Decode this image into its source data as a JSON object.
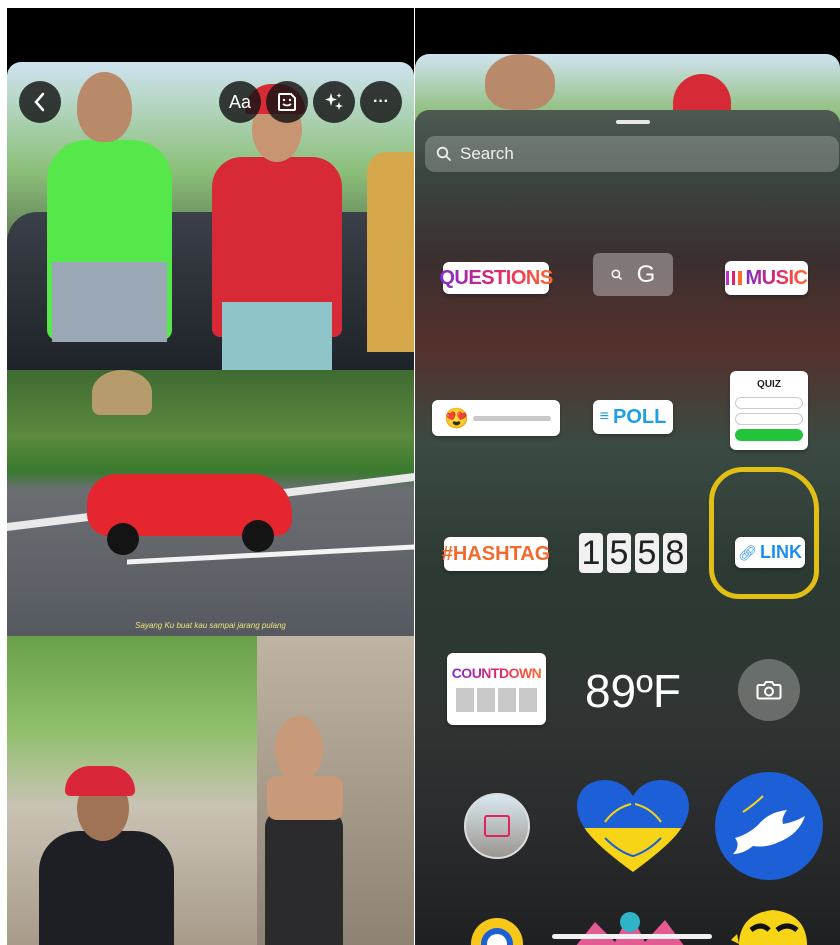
{
  "left_panel": {
    "toolbar": {
      "back_icon": "chevron-left-icon",
      "text_label": "Aa",
      "sticker_icon": "sticker-icon",
      "effects_icon": "sparkles-icon",
      "more_label": "···"
    },
    "caption": "Sayang Ku buat kau sampai jarang pulang"
  },
  "right_panel": {
    "search": {
      "placeholder": "Search",
      "icon": "search-icon"
    },
    "stickers": {
      "questions": "QUESTIONS",
      "gif_letter": "G",
      "music": "MUSIC",
      "poll": "POLL",
      "quiz_title": "QUIZ",
      "hashtag": "#HASHTAG",
      "time_digits": [
        "1",
        "5",
        "5",
        "8"
      ],
      "link": "LINK",
      "countdown": "COUNTDOWN",
      "temperature": "89ºF"
    },
    "colors": {
      "accent_gradient_start": "#7a2fd0",
      "accent_gradient_end": "#ff6a2f",
      "poll_blue": "#1fa0e6",
      "link_blue": "#1f8cf0",
      "highlight_yellow": "#e2bf16",
      "ukraine_blue": "#1d5fd6",
      "ukraine_yellow": "#f7d416"
    }
  }
}
